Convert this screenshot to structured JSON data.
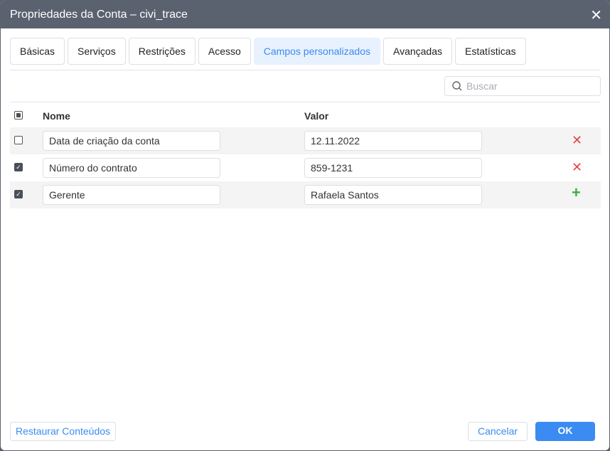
{
  "title": "Propriedades da Conta – civi_trace",
  "tabs": [
    "Básicas",
    "Serviços",
    "Restrições",
    "Acesso",
    "Campos personalizados",
    "Avançadas",
    "Estatísticas"
  ],
  "active_tab": "Campos personalizados",
  "search": {
    "placeholder": "Buscar"
  },
  "columns": {
    "name": "Nome",
    "value": "Valor"
  },
  "rows": [
    {
      "checked": false,
      "name": "Data de criação da conta",
      "value": "12.11.2022",
      "action": "delete"
    },
    {
      "checked": true,
      "name": "Número do contrato",
      "value": "859-1231",
      "action": "delete"
    },
    {
      "checked": true,
      "name": "Gerente",
      "value": "Rafaela Santos",
      "action": "add"
    }
  ],
  "footer": {
    "restore": "Restaurar Conteúdos",
    "cancel": "Cancelar",
    "ok": "OK"
  },
  "colors": {
    "accent": "#3b8bf2",
    "delete": "#e84343",
    "add": "#3bb04a"
  }
}
